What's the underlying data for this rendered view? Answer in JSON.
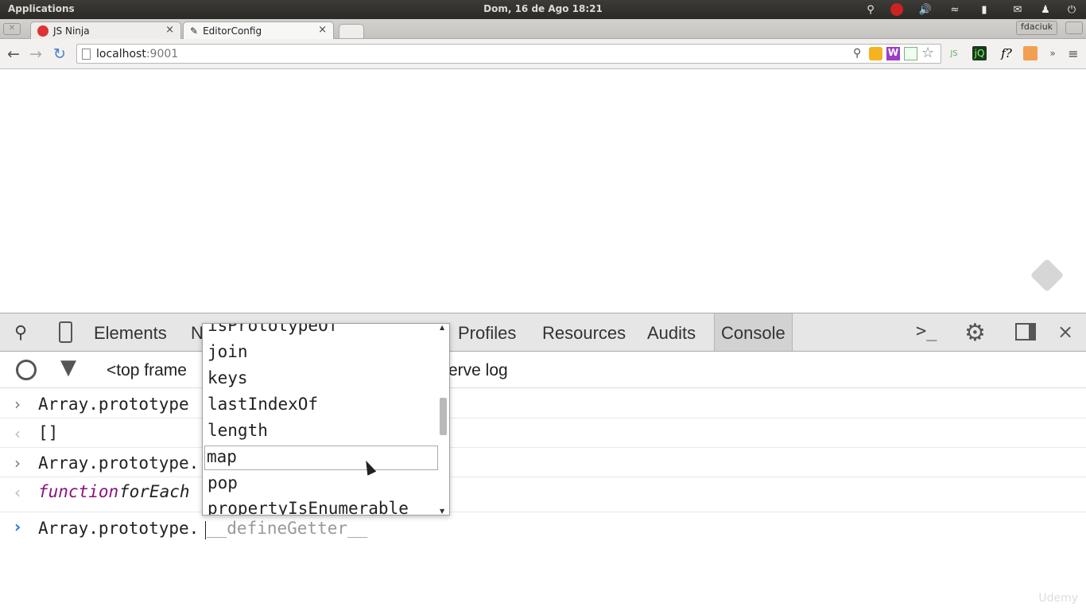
{
  "topbar": {
    "apps_label": "Applications",
    "clock": "Dom, 16 de Ago 18:21"
  },
  "tabs": [
    {
      "title": "JS Ninja"
    },
    {
      "title": "EditorConfig"
    }
  ],
  "profile_button": "fdaciuk",
  "omnibox": {
    "host": "localhost",
    "port": ":9001"
  },
  "devtools": {
    "tabs": [
      "Elements",
      "N",
      "Profiles",
      "Resources",
      "Audits",
      "Console"
    ],
    "frame_selector": "<top frame",
    "preserve_log_fragment": "erve log",
    "console_lines": [
      {
        "kind": "input",
        "text": "Array.prototype"
      },
      {
        "kind": "output",
        "text": "[]"
      },
      {
        "kind": "input",
        "text": "Array.prototype."
      },
      {
        "kind": "output_fn_kw",
        "text": "function",
        "rest": "forEach"
      }
    ],
    "prompt_text": "Array.prototype.",
    "prompt_hint": "__defineGetter__"
  },
  "autocomplete": {
    "items": [
      "isPrototypeOf",
      "join",
      "keys",
      "lastIndexOf",
      "length",
      "map",
      "pop",
      "propertyIsEnumerable"
    ],
    "selected": "map"
  },
  "watermark": "Udemy"
}
